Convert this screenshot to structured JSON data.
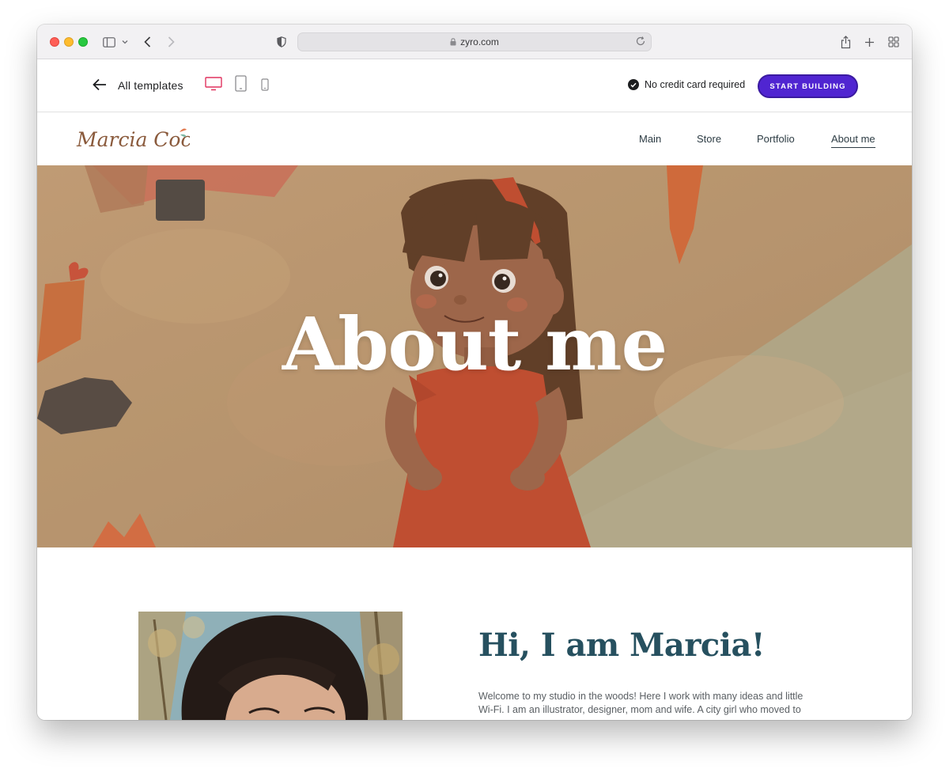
{
  "browser": {
    "url": "zyro.com"
  },
  "zyro_bar": {
    "back_label": "All templates",
    "no_credit_card": "No credit card required",
    "cta_label": "START BUILDING",
    "accent_color": "#5025d1",
    "active_device_color": "#e0325f"
  },
  "site": {
    "logo_text": "Marcia Cocco",
    "nav": [
      {
        "label": "Main"
      },
      {
        "label": "Store"
      },
      {
        "label": "Portfolio"
      },
      {
        "label": "About me",
        "active": true
      }
    ]
  },
  "hero": {
    "title": "About me"
  },
  "about": {
    "heading": "Hi, I am Marcia!",
    "intro": "Welcome to my studio in the woods! Here I work with many ideas and little Wi-Fi. I am an illustrator, designer, mom and wife. A city girl who moved to"
  }
}
